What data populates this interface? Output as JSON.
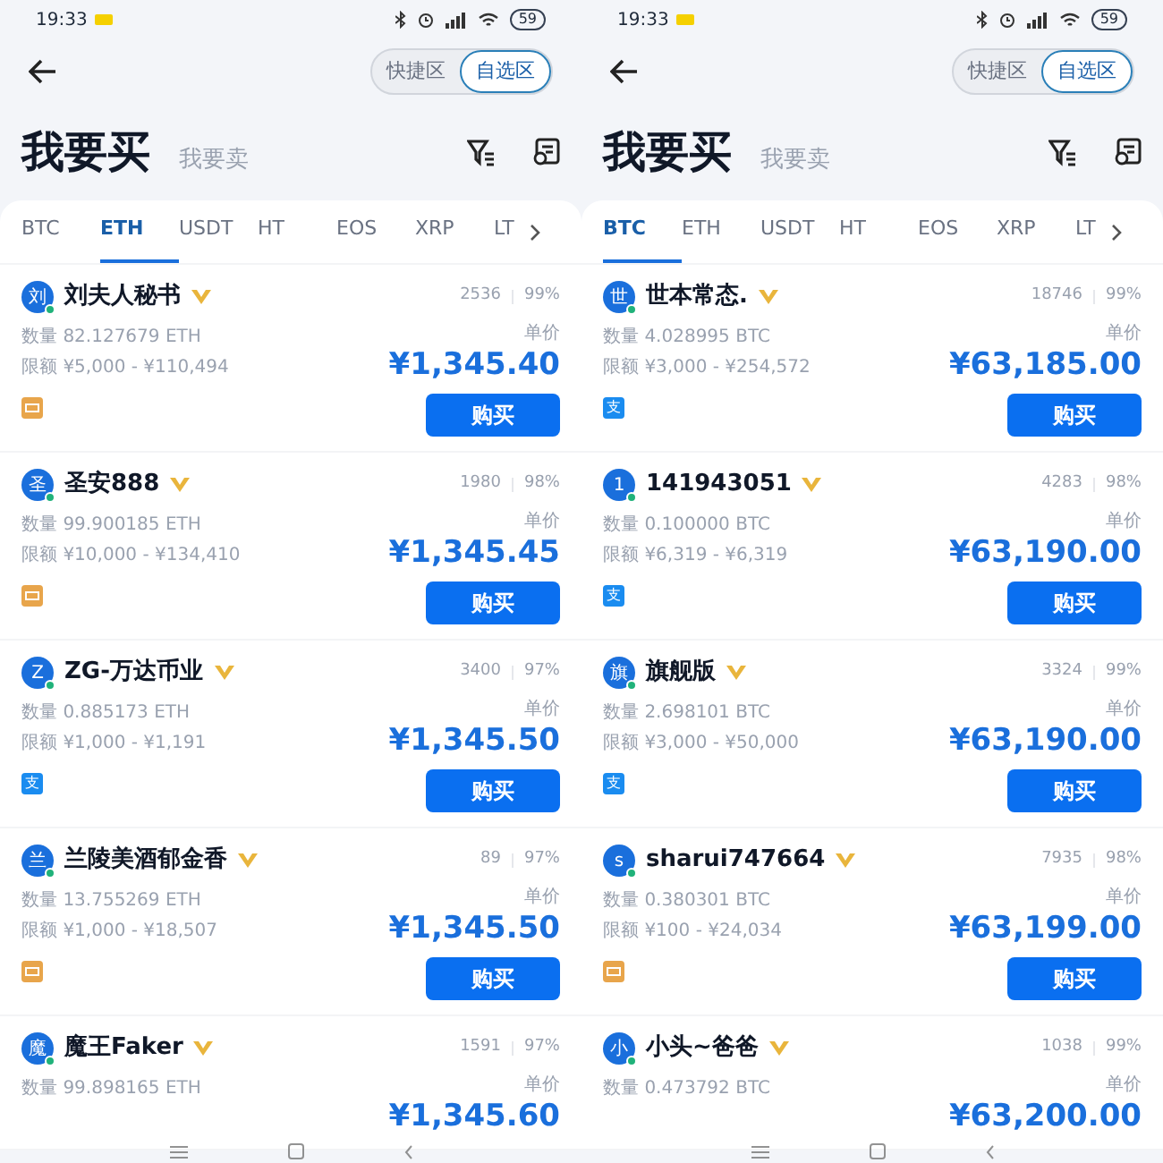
{
  "panels": [
    {
      "status_bar": {
        "time": "19:33",
        "battery": "59"
      },
      "view_toggle": [
        {
          "label": "快捷区",
          "selected": false
        },
        {
          "label": "自选区",
          "selected": true
        }
      ],
      "mode_tabs": [
        {
          "label": "我要买",
          "selected": true
        },
        {
          "label": "我要卖",
          "selected": false
        }
      ],
      "coin_tabs": [
        {
          "label": "BTC",
          "selected": false
        },
        {
          "label": "ETH",
          "selected": true
        },
        {
          "label": "USDT",
          "selected": false
        },
        {
          "label": "HT",
          "selected": false
        },
        {
          "label": "EOS",
          "selected": false
        },
        {
          "label": "XRP",
          "selected": false
        },
        {
          "label": "LT",
          "selected": false
        }
      ],
      "listings": [
        {
          "avatar": "刘",
          "online": true,
          "name": "刘夫人秘书",
          "trades": "2536",
          "rate": "99%",
          "qty_label": "数量",
          "qty": "82.127679 ETH",
          "limit_label": "限额",
          "limit": "¥5,000 - ¥110,494",
          "price_label": "单价",
          "price": "¥1,345.40",
          "payment": {
            "kind": "bank"
          },
          "button": "购买"
        },
        {
          "avatar": "圣",
          "online": true,
          "name": "圣安888",
          "trades": "1980",
          "rate": "98%",
          "qty_label": "数量",
          "qty": "99.900185 ETH",
          "limit_label": "限额",
          "limit": "¥10,000 - ¥134,410",
          "price_label": "单价",
          "price": "¥1,345.45",
          "payment": {
            "kind": "bank"
          },
          "button": "购买"
        },
        {
          "avatar": "Z",
          "online": true,
          "name": "ZG-万达币业",
          "trades": "3400",
          "rate": "97%",
          "qty_label": "数量",
          "qty": "0.885173 ETH",
          "limit_label": "限额",
          "limit": "¥1,000 - ¥1,191",
          "price_label": "单价",
          "price": "¥1,345.50",
          "payment": {
            "kind": "alipay",
            "mark": "支"
          },
          "button": "购买"
        },
        {
          "avatar": "兰",
          "online": true,
          "name": "兰陵美酒郁金香",
          "trades": "89",
          "rate": "97%",
          "qty_label": "数量",
          "qty": "13.755269 ETH",
          "limit_label": "限额",
          "limit": "¥1,000 - ¥18,507",
          "price_label": "单价",
          "price": "¥1,345.50",
          "payment": {
            "kind": "bank"
          },
          "button": "购买"
        },
        {
          "avatar": "魔",
          "online": true,
          "name": "魔王Faker",
          "trades": "1591",
          "rate": "97%",
          "qty_label": "数量",
          "qty": "99.898165 ETH",
          "price_label": "单价",
          "price": "¥1,345.60"
        }
      ]
    },
    {
      "status_bar": {
        "time": "19:33",
        "battery": "59"
      },
      "view_toggle": [
        {
          "label": "快捷区",
          "selected": false
        },
        {
          "label": "自选区",
          "selected": true
        }
      ],
      "mode_tabs": [
        {
          "label": "我要买",
          "selected": true
        },
        {
          "label": "我要卖",
          "selected": false
        }
      ],
      "coin_tabs": [
        {
          "label": "BTC",
          "selected": true
        },
        {
          "label": "ETH",
          "selected": false
        },
        {
          "label": "USDT",
          "selected": false
        },
        {
          "label": "HT",
          "selected": false
        },
        {
          "label": "EOS",
          "selected": false
        },
        {
          "label": "XRP",
          "selected": false
        },
        {
          "label": "LT",
          "selected": false
        }
      ],
      "listings": [
        {
          "avatar": "世",
          "online": true,
          "name": "世本常态.",
          "trades": "18746",
          "rate": "99%",
          "qty_label": "数量",
          "qty": "4.028995 BTC",
          "limit_label": "限额",
          "limit": "¥3,000 - ¥254,572",
          "price_label": "单价",
          "price": "¥63,185.00",
          "payment": {
            "kind": "alipay",
            "mark": "支"
          },
          "button": "购买"
        },
        {
          "avatar": "1",
          "online": true,
          "name": "141943051",
          "trades": "4283",
          "rate": "98%",
          "qty_label": "数量",
          "qty": "0.100000 BTC",
          "limit_label": "限额",
          "limit": "¥6,319 - ¥6,319",
          "price_label": "单价",
          "price": "¥63,190.00",
          "payment": {
            "kind": "alipay",
            "mark": "支"
          },
          "button": "购买"
        },
        {
          "avatar": "旗",
          "online": true,
          "name": "旗舰版",
          "trades": "3324",
          "rate": "99%",
          "qty_label": "数量",
          "qty": "2.698101 BTC",
          "limit_label": "限额",
          "limit": "¥3,000 - ¥50,000",
          "price_label": "单价",
          "price": "¥63,190.00",
          "payment": {
            "kind": "alipay",
            "mark": "支"
          },
          "button": "购买"
        },
        {
          "avatar": "s",
          "online": true,
          "name": "sharui747664",
          "trades": "7935",
          "rate": "98%",
          "qty_label": "数量",
          "qty": "0.380301 BTC",
          "limit_label": "限额",
          "limit": "¥100 - ¥24,034",
          "price_label": "单价",
          "price": "¥63,199.00",
          "payment": {
            "kind": "bank"
          },
          "button": "购买"
        },
        {
          "avatar": "小",
          "online": true,
          "name": "小头~爸爸",
          "trades": "1038",
          "rate": "99%",
          "qty_label": "数量",
          "qty": "0.473792 BTC",
          "price_label": "单价",
          "price": "¥63,200.00"
        }
      ]
    }
  ]
}
